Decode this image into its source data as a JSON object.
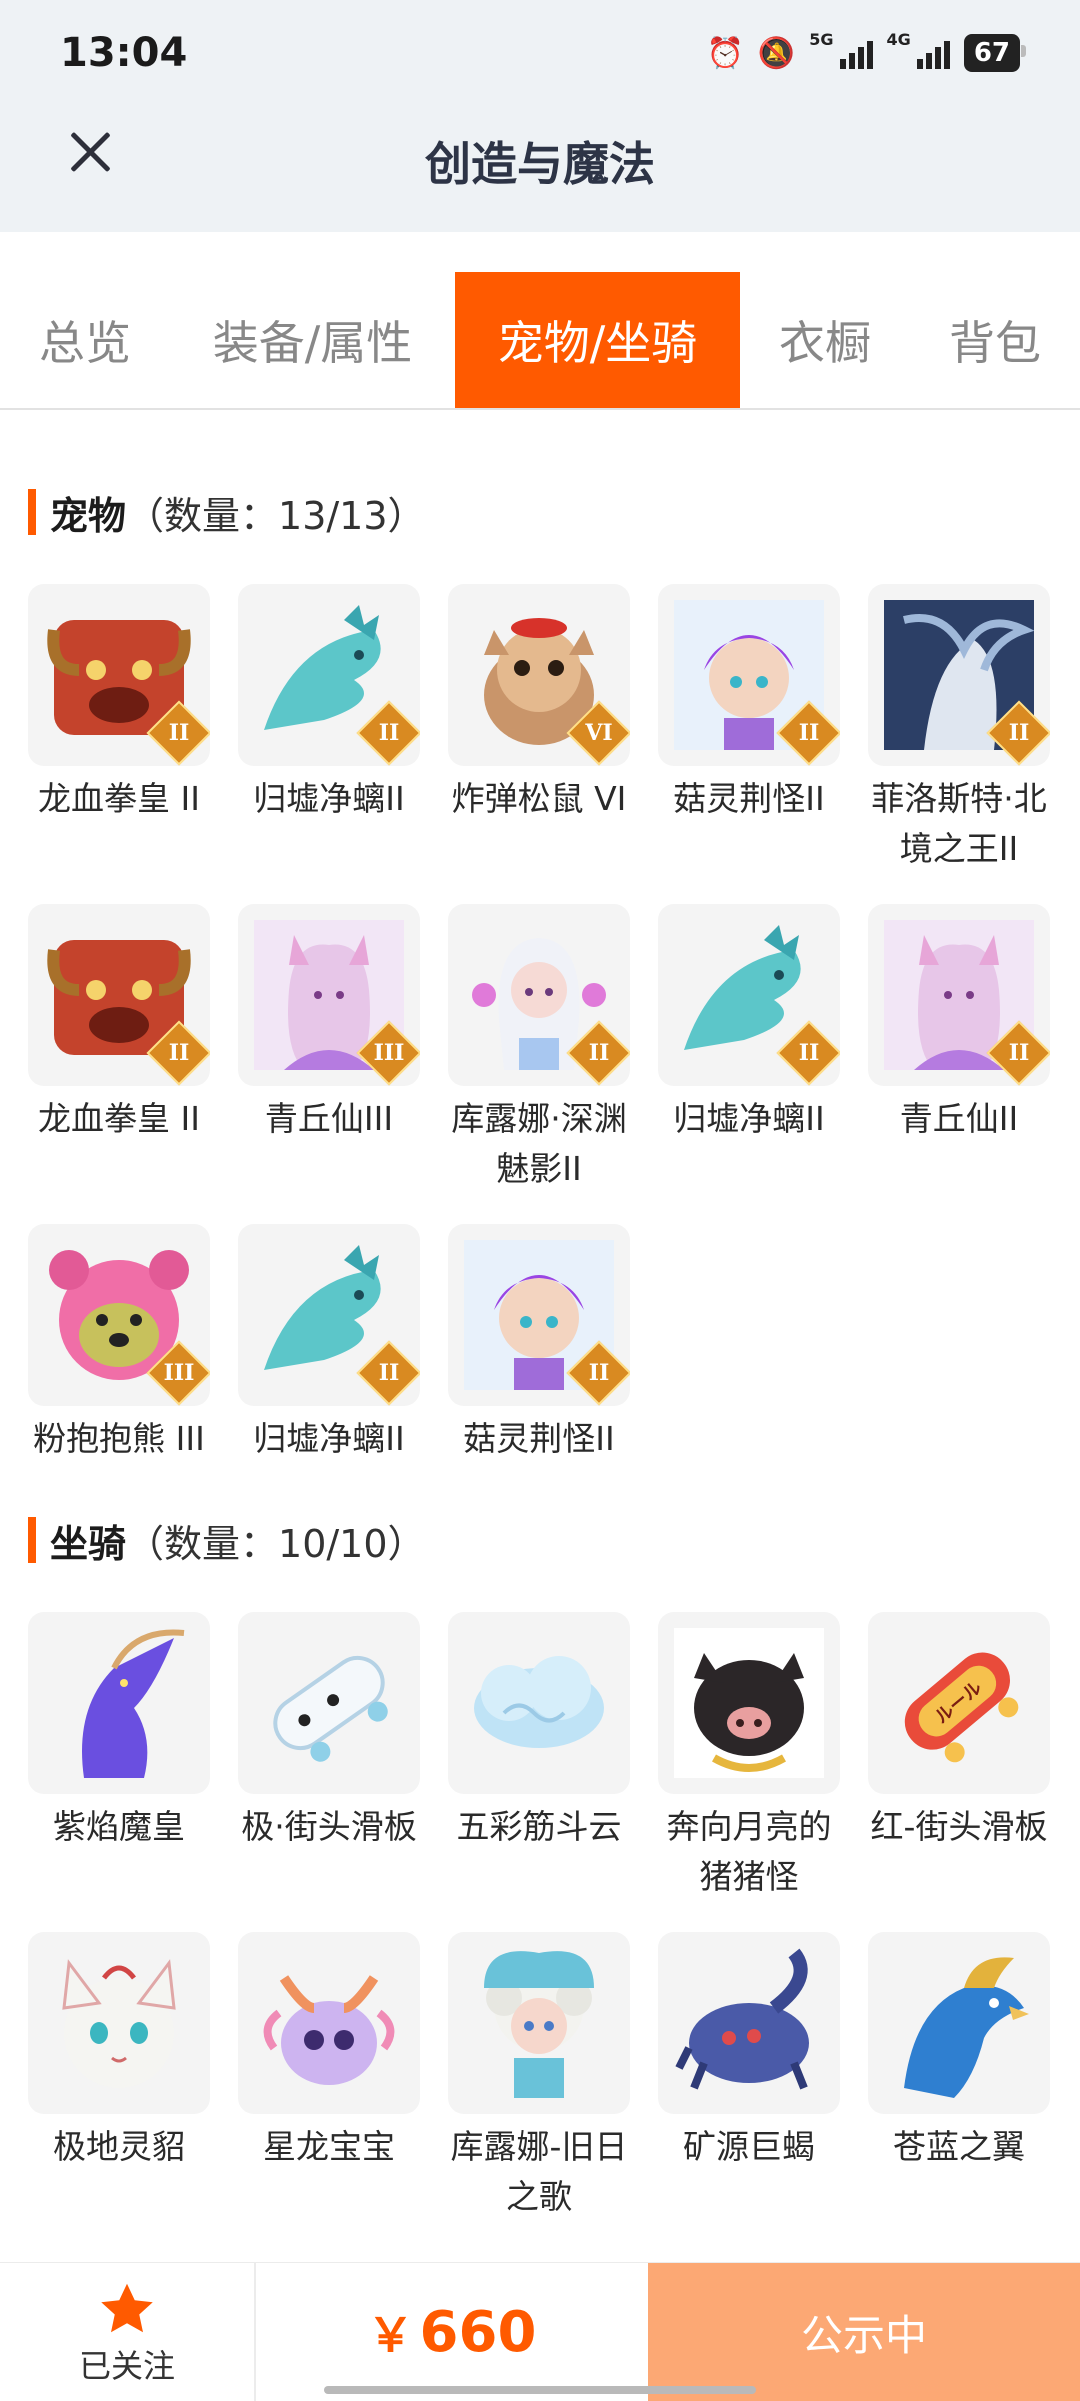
{
  "status_bar": {
    "time": "13:04",
    "net_5g": "5G",
    "net_4g": "4G",
    "battery": "67"
  },
  "header": {
    "title": "创造与魔法"
  },
  "tabs": [
    {
      "label": "总览",
      "active": false
    },
    {
      "label": "装备/属性",
      "active": false
    },
    {
      "label": "宠物/坐骑",
      "active": true
    },
    {
      "label": "衣橱",
      "active": false
    },
    {
      "label": "背包",
      "active": false
    }
  ],
  "pets": {
    "title": "宠物",
    "count": "（数量：13/13）",
    "items": [
      {
        "name": "龙血拳皇 II",
        "rank": "II",
        "icon": "red-beast"
      },
      {
        "name": "归墟净螭II",
        "rank": "II",
        "icon": "teal-dragon"
      },
      {
        "name": "炸弹松鼠 VI",
        "rank": "VI",
        "icon": "squirrel"
      },
      {
        "name": "菇灵荆怪II",
        "rank": "II",
        "icon": "purple-sprite"
      },
      {
        "name": "菲洛斯特·北境之王II",
        "rank": "II",
        "icon": "ice-king"
      },
      {
        "name": "龙血拳皇 II",
        "rank": "II",
        "icon": "red-beast"
      },
      {
        "name": "青丘仙III",
        "rank": "III",
        "icon": "fox-fairy"
      },
      {
        "name": "库露娜·深渊魅影II",
        "rank": "II",
        "icon": "white-fairy"
      },
      {
        "name": "归墟净螭II",
        "rank": "II",
        "icon": "teal-dragon"
      },
      {
        "name": "青丘仙II",
        "rank": "II",
        "icon": "fox-fairy"
      },
      {
        "name": "粉抱抱熊 III",
        "rank": "III",
        "icon": "pink-bear"
      },
      {
        "name": "归墟净螭II",
        "rank": "II",
        "icon": "teal-dragon"
      },
      {
        "name": "菇灵荆怪II",
        "rank": "II",
        "icon": "purple-sprite"
      }
    ]
  },
  "mounts": {
    "title": "坐骑",
    "count": "（数量：10/10）",
    "items": [
      {
        "name": "紫焰魔皇",
        "icon": "purple-bird"
      },
      {
        "name": "极·街头滑板",
        "icon": "white-skateboard"
      },
      {
        "name": "五彩筋斗云",
        "icon": "cloud"
      },
      {
        "name": "奔向月亮的猪猪怪",
        "icon": "black-pig"
      },
      {
        "name": "红-街头滑板",
        "icon": "red-skateboard"
      },
      {
        "name": "极地灵貂",
        "icon": "white-cat"
      },
      {
        "name": "星龙宝宝",
        "icon": "baby-dragon"
      },
      {
        "name": "库露娜-旧日之歌",
        "icon": "sheep-girl"
      },
      {
        "name": "矿源巨蝎",
        "icon": "blue-scorpion"
      },
      {
        "name": "苍蓝之翼",
        "icon": "blue-eagle"
      }
    ]
  },
  "bottom_bar": {
    "follow_label": "已关注",
    "currency": "￥",
    "price": "660",
    "status_label": "公示中"
  },
  "colors": {
    "accent": "#ff5a00",
    "status_button": "#fca874",
    "rank_badge": "#d98a21"
  }
}
